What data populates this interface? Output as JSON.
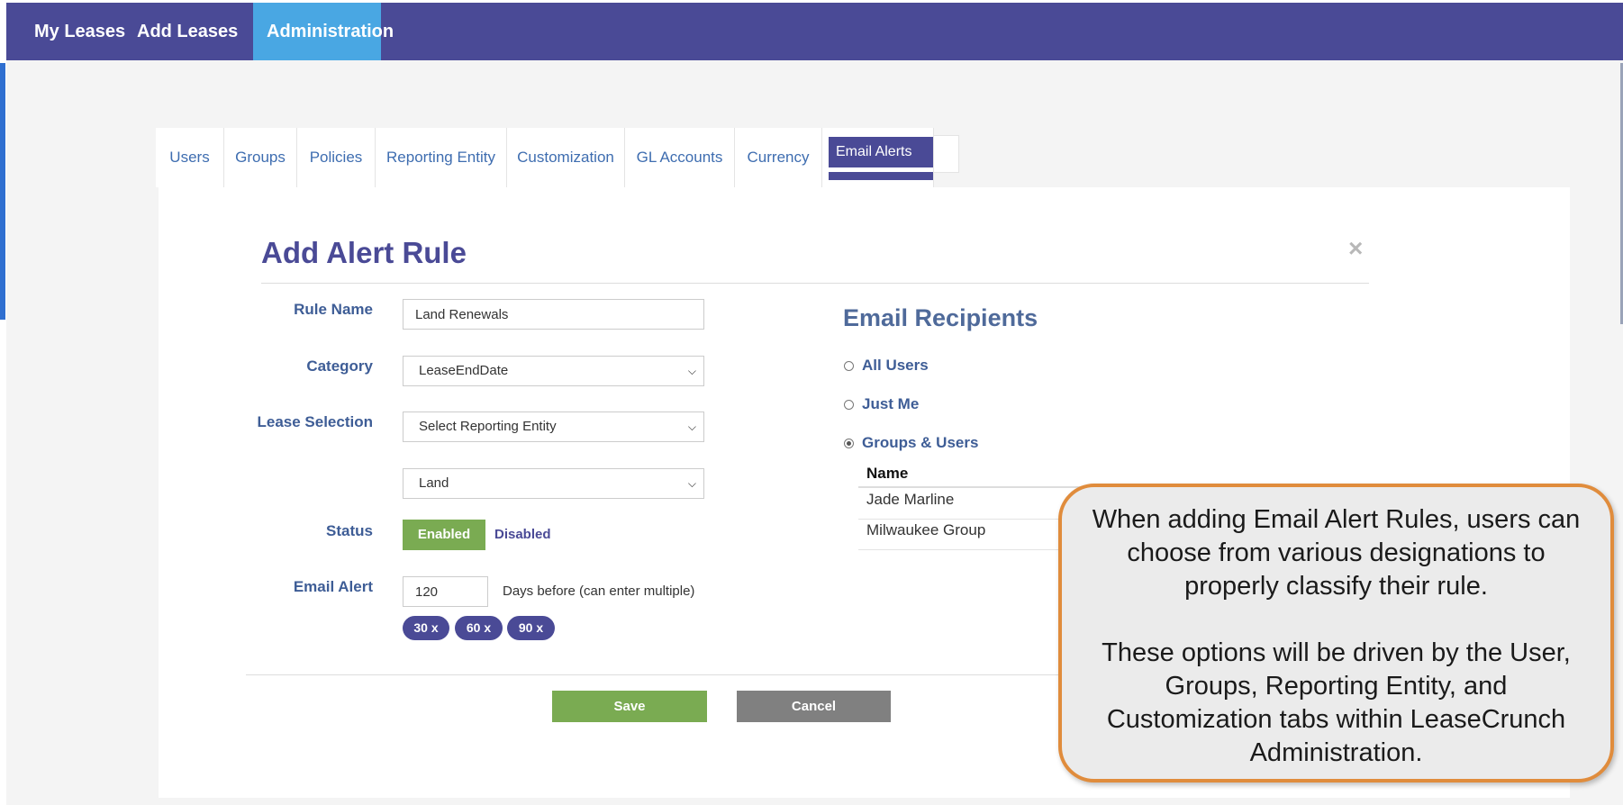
{
  "topnav": {
    "items": [
      {
        "label": "My Leases"
      },
      {
        "label": "Add Leases"
      },
      {
        "label": "Administration"
      }
    ]
  },
  "tabs": [
    {
      "label": "Users"
    },
    {
      "label": "Groups"
    },
    {
      "label": "Policies"
    },
    {
      "label": "Reporting Entity"
    },
    {
      "label": "Customization"
    },
    {
      "label": "GL Accounts"
    },
    {
      "label": "Currency"
    },
    {
      "label": "Email Alerts"
    }
  ],
  "modal": {
    "title": "Add Alert Rule",
    "close": "×",
    "labels": {
      "rule_name": "Rule Name",
      "category": "Category",
      "lease_selection": "Lease Selection",
      "status": "Status",
      "email_alert": "Email Alert"
    },
    "fields": {
      "rule_name": "Land Renewals",
      "category": "LeaseEndDate",
      "lease_selection": "Select Reporting Entity",
      "lease_subselection": "Land",
      "days": "120"
    },
    "status": {
      "enabled": "Enabled",
      "disabled": "Disabled"
    },
    "days_hint": "Days before (can enter multiple)",
    "chips": [
      "30 x",
      "60 x",
      "90 x"
    ],
    "save": "Save",
    "cancel": "Cancel"
  },
  "recipients": {
    "title": "Email Recipients",
    "options": [
      "All Users",
      "Just Me",
      "Groups & Users"
    ],
    "selected": "Groups & Users",
    "table": {
      "header": "Name",
      "rows": [
        "Jade Marline",
        "Milwaukee Group"
      ]
    }
  },
  "callout": {
    "paragraph1": "When adding Email Alert Rules, users can choose from various designations to properly classify their rule.",
    "paragraph2": "These options will be driven by the User, Groups, Reporting Entity, and Customization tabs within LeaseCrunch Administration."
  }
}
